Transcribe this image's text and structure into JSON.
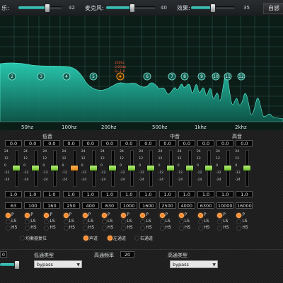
{
  "topbar": {
    "music_label": "乐:",
    "music_value": "42",
    "mic_label": "麦克风:",
    "mic_value": "40",
    "effect_label": "效果:",
    "effect_value": "35",
    "auto_label": "自感"
  },
  "spectrum": {
    "freq_labels": [
      "50hz",
      "100hz",
      "200hz",
      "500hz",
      "1khz",
      "2khz"
    ],
    "bands": [
      {
        "num": "2"
      },
      {
        "num": "3"
      },
      {
        "num": "4"
      },
      {
        "num": "5"
      },
      {
        "num": "6"
      },
      {
        "num": "7"
      },
      {
        "num": "8"
      },
      {
        "num": "9"
      },
      {
        "num": "10"
      },
      {
        "num": "11"
      },
      {
        "num": "12"
      }
    ],
    "selected_marker": {
      "line1": "250hz",
      "line2": "0.00db",
      "line3": "Q=1.0"
    }
  },
  "sections": {
    "low": "低音",
    "mid": "中音",
    "high": "高音"
  },
  "channels": [
    {
      "gain": "0.0",
      "q": "1.0",
      "freq": "63",
      "sel": "P"
    },
    {
      "gain": "0.0",
      "q": "1.0",
      "freq": "100",
      "sel": "P"
    },
    {
      "gain": "0.0",
      "q": "1.0",
      "freq": "160",
      "sel": "P"
    },
    {
      "gain": "0.0",
      "q": "1.0",
      "freq": "250",
      "sel": "P"
    },
    {
      "gain": "0.0",
      "q": "1.0",
      "freq": "400",
      "sel": "P"
    },
    {
      "gain": "0.0",
      "q": "1.0",
      "freq": "630",
      "sel": "P"
    },
    {
      "gain": "0.0",
      "q": "1.0",
      "freq": "1000",
      "sel": "P"
    },
    {
      "gain": "0.0",
      "q": "1.0",
      "freq": "1600",
      "sel": "P"
    },
    {
      "gain": "0.0",
      "q": "1.0",
      "freq": "2500",
      "sel": "P"
    },
    {
      "gain": "0.0",
      "q": "1.0",
      "freq": "4000",
      "sel": "P"
    },
    {
      "gain": "0.0",
      "q": "1.0",
      "freq": "6300",
      "sel": "P"
    },
    {
      "gain": "0.0",
      "q": "1.0",
      "freq": "10000",
      "sel": "P"
    },
    {
      "gain": "0.0",
      "q": "1.0",
      "freq": "16000",
      "sel": "P"
    }
  ],
  "db_scale": [
    "24",
    "12",
    "0",
    "-12",
    "-24"
  ],
  "radio_labels": {
    "p": "P",
    "ls": "LS",
    "hs": "HS"
  },
  "bottom_options": {
    "eq_reset": "均衡器复位",
    "sound": "声道",
    "left": "左通道",
    "right": "右通道"
  },
  "bottom_controls": {
    "value0": "0",
    "lowpass_type_label": "低通类型",
    "lowpass_type_value": "bypass",
    "highpass_freq_label": "高通频率",
    "highpass_freq_value": "20",
    "highpass_type_label": "高通类型",
    "highpass_type_value": "bypass"
  }
}
